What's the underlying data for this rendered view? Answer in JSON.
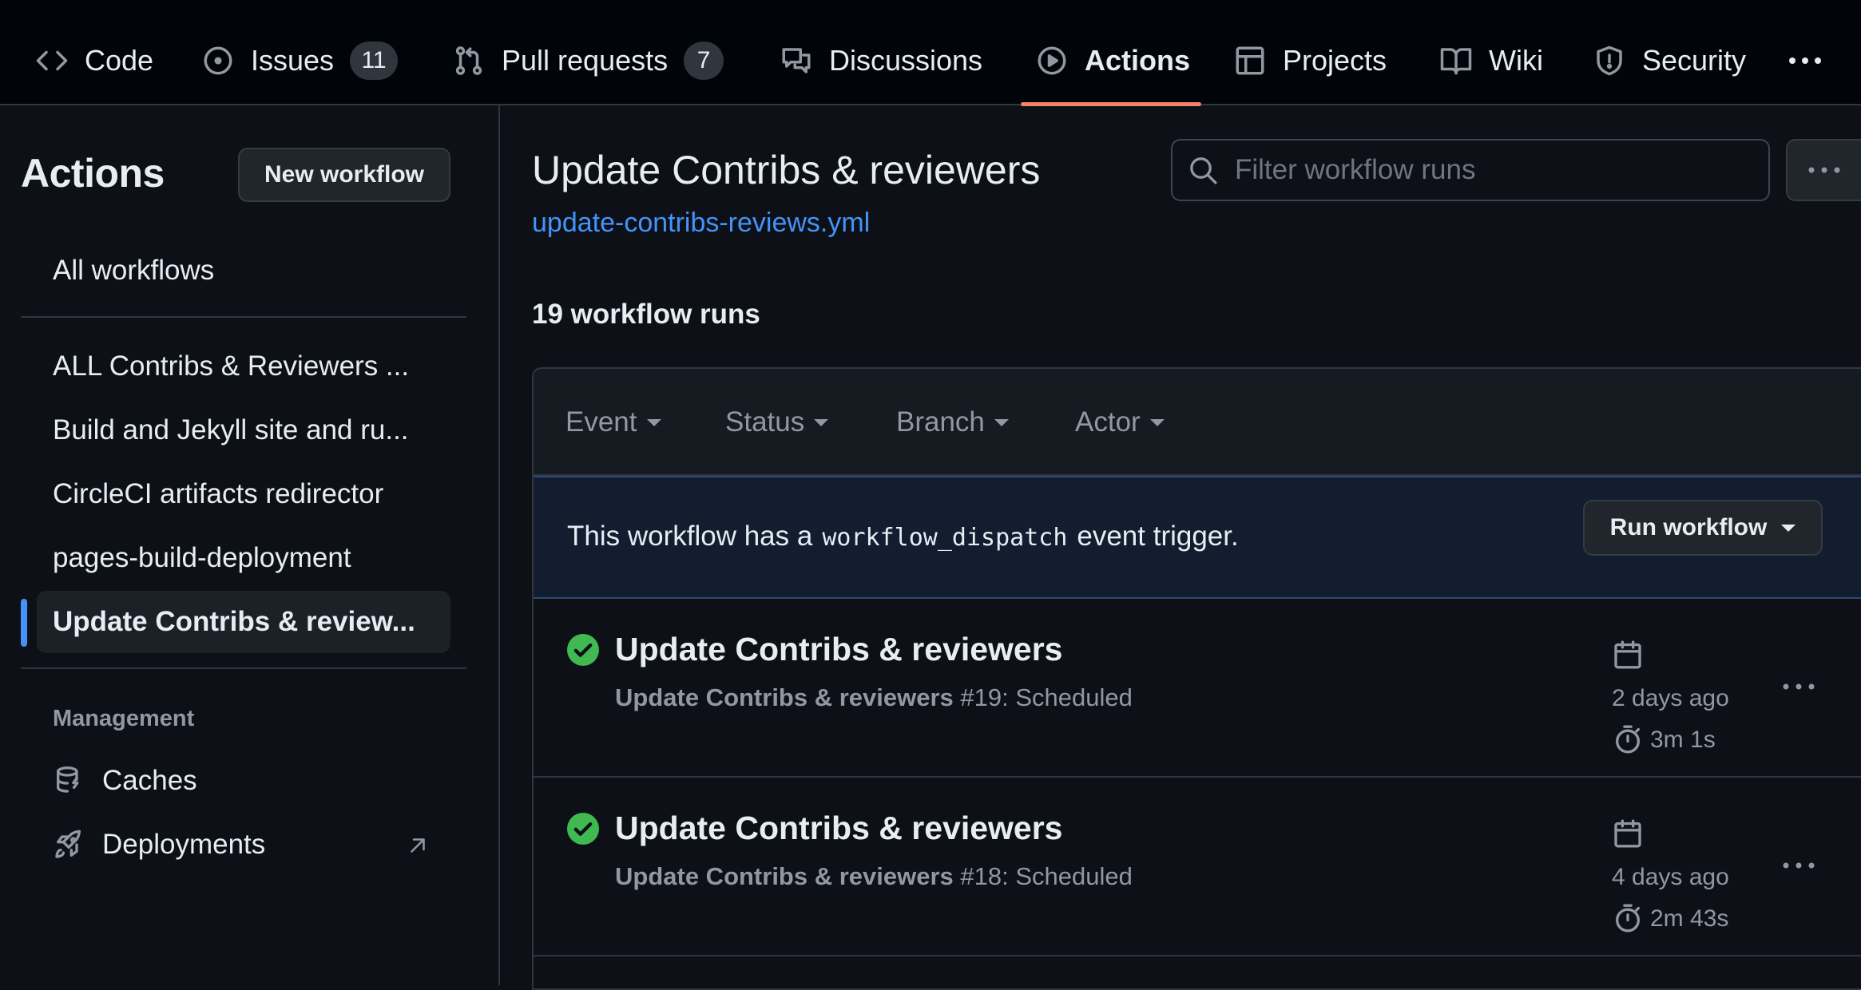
{
  "nav": {
    "items": [
      {
        "label": "Code",
        "icon": "code-icon"
      },
      {
        "label": "Issues",
        "icon": "issue-opened-icon",
        "count": "11"
      },
      {
        "label": "Pull requests",
        "icon": "git-pull-request-icon",
        "count": "7"
      },
      {
        "label": "Discussions",
        "icon": "comment-discussion-icon"
      },
      {
        "label": "Actions",
        "icon": "play-icon",
        "selected": true
      },
      {
        "label": "Projects",
        "icon": "table-icon"
      },
      {
        "label": "Wiki",
        "icon": "book-icon"
      },
      {
        "label": "Security",
        "icon": "shield-icon"
      }
    ],
    "more_icon": "kebab-horizontal-icon",
    "accent_color": "#f78166"
  },
  "sidebar": {
    "title": "Actions",
    "new_workflow_label": "New workflow",
    "all_workflows": "All workflows",
    "workflows": [
      "ALL Contribs & Reviewers ...",
      "Build and Jekyll site and ru...",
      "CircleCI artifacts redirector",
      "pages-build-deployment",
      "Update Contribs & review..."
    ],
    "active_workflow_index": 4,
    "management_heading": "Management",
    "management_items": [
      {
        "label": "Caches",
        "icon": "database-icon"
      },
      {
        "label": "Deployments",
        "icon": "rocket-icon",
        "trailing_icon": "arrow-up-right-icon"
      }
    ]
  },
  "main": {
    "title": "Update Contribs & reviewers",
    "file_link": "update-contribs-reviews.yml",
    "filter_placeholder": "Filter workflow runs",
    "runs_count": "19 workflow runs",
    "filters": [
      "Event",
      "Status",
      "Branch",
      "Actor"
    ],
    "dispatch": {
      "prefix": "This workflow has a",
      "code": "workflow_dispatch",
      "suffix": "event trigger.",
      "button": "Run workflow"
    },
    "runs": [
      {
        "title": "Update Contribs & reviewers",
        "workflow_name": "Update Contribs & reviewers",
        "run_suffix": "#19: Scheduled",
        "date": "2 days ago",
        "duration": "3m 1s",
        "status": "success"
      },
      {
        "title": "Update Contribs & reviewers",
        "workflow_name": "Update Contribs & reviewers",
        "run_suffix": "#18: Scheduled",
        "date": "4 days ago",
        "duration": "2m 43s",
        "status": "success"
      }
    ],
    "success_color": "#3fb950",
    "link_color": "#4493f8"
  }
}
